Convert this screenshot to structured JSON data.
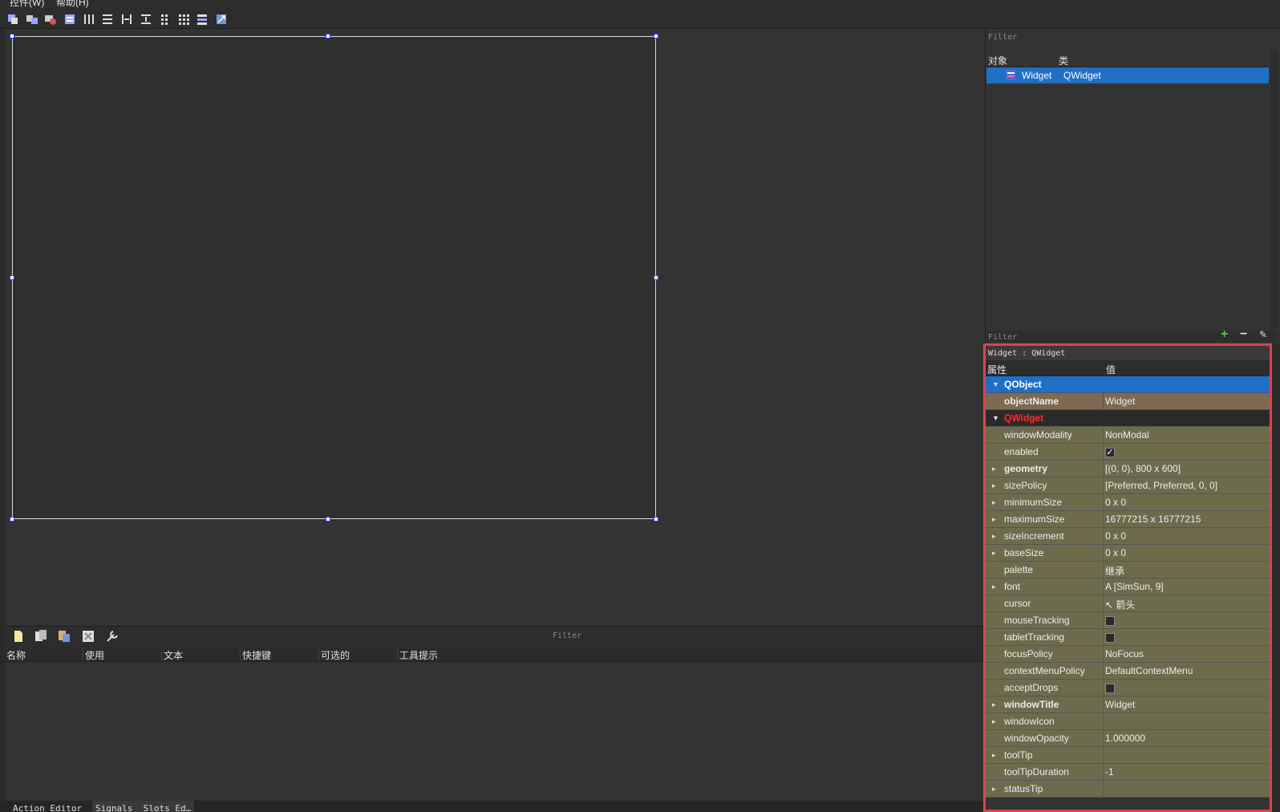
{
  "menubar": {
    "items": [
      "控件(W)",
      "帮助(H)"
    ]
  },
  "canvas": {
    "form_size": "800 x 600"
  },
  "action_editor": {
    "filter_placeholder": "Filter",
    "columns": [
      "名称",
      "使用",
      "文本",
      "快捷键",
      "可选的",
      "工具提示"
    ]
  },
  "bottom_tabs": [
    "Action Editor",
    "Signals _Slots Ed…"
  ],
  "object_inspector": {
    "filter_placeholder": "Filter",
    "col_object": "对象",
    "col_class": "类",
    "row": {
      "object": "Widget",
      "class": "QWidget"
    }
  },
  "property_editor": {
    "filter_placeholder": "Filter",
    "title": "Widget : QWidget",
    "col_property": "属性",
    "col_value": "值",
    "rows": [
      {
        "name": "QObject",
        "value": "",
        "kind": "cat",
        "expander": "▼"
      },
      {
        "name": "objectName",
        "value": "Widget",
        "kind": "objname",
        "bold": true,
        "expander": ""
      },
      {
        "name": "QWidget",
        "value": "",
        "kind": "cat2",
        "expander": "▼"
      },
      {
        "name": "windowModality",
        "value": "NonModal",
        "kind": "row",
        "expander": ""
      },
      {
        "name": "enabled",
        "value": "✓",
        "kind": "check",
        "expander": ""
      },
      {
        "name": "geometry",
        "value": "[(0, 0), 800 x 600]",
        "kind": "row",
        "bold": true,
        "expander": "▸"
      },
      {
        "name": "sizePolicy",
        "value": "[Preferred, Preferred, 0, 0]",
        "kind": "row",
        "expander": "▸"
      },
      {
        "name": "minimumSize",
        "value": "0 x 0",
        "kind": "row",
        "expander": "▸"
      },
      {
        "name": "maximumSize",
        "value": "16777215 x 16777215",
        "kind": "row",
        "expander": "▸"
      },
      {
        "name": "sizeIncrement",
        "value": "0 x 0",
        "kind": "row",
        "expander": "▸"
      },
      {
        "name": "baseSize",
        "value": "0 x 0",
        "kind": "row",
        "expander": "▸"
      },
      {
        "name": "palette",
        "value": "继承",
        "kind": "row",
        "expander": ""
      },
      {
        "name": "font",
        "value": "A  [SimSun, 9]",
        "kind": "row",
        "expander": "▸"
      },
      {
        "name": "cursor",
        "value": "↖  箭头",
        "kind": "row",
        "expander": ""
      },
      {
        "name": "mouseTracking",
        "value": "",
        "kind": "check",
        "expander": ""
      },
      {
        "name": "tabletTracking",
        "value": "",
        "kind": "check",
        "expander": ""
      },
      {
        "name": "focusPolicy",
        "value": "NoFocus",
        "kind": "row",
        "expander": ""
      },
      {
        "name": "contextMenuPolicy",
        "value": "DefaultContextMenu",
        "kind": "row",
        "expander": ""
      },
      {
        "name": "acceptDrops",
        "value": "",
        "kind": "check",
        "expander": ""
      },
      {
        "name": "windowTitle",
        "value": "Widget",
        "kind": "row",
        "bold": true,
        "expander": "▸"
      },
      {
        "name": "windowIcon",
        "value": "",
        "kind": "row",
        "expander": "▸"
      },
      {
        "name": "windowOpacity",
        "value": "1.000000",
        "kind": "row",
        "expander": ""
      },
      {
        "name": "toolTip",
        "value": "",
        "kind": "row",
        "expander": "▸"
      },
      {
        "name": "toolTipDuration",
        "value": "-1",
        "kind": "row",
        "expander": ""
      },
      {
        "name": "statusTip",
        "value": "",
        "kind": "row",
        "expander": "▸"
      }
    ]
  },
  "colors": {
    "selection": "#1f6fc7",
    "highlight_border": "#e0414d",
    "property_bg": "#6e6b4d"
  },
  "icons": [
    "edit-widgets-icon",
    "edit-signals-icon",
    "edit-buddies-icon",
    "edit-tab-order-icon",
    "layout-horizontal-icon",
    "layout-vertical-icon",
    "splitter-horizontal-icon",
    "splitter-vertical-icon",
    "layout-form-icon",
    "layout-grid-icon",
    "break-layout-icon",
    "adjust-size-icon"
  ]
}
